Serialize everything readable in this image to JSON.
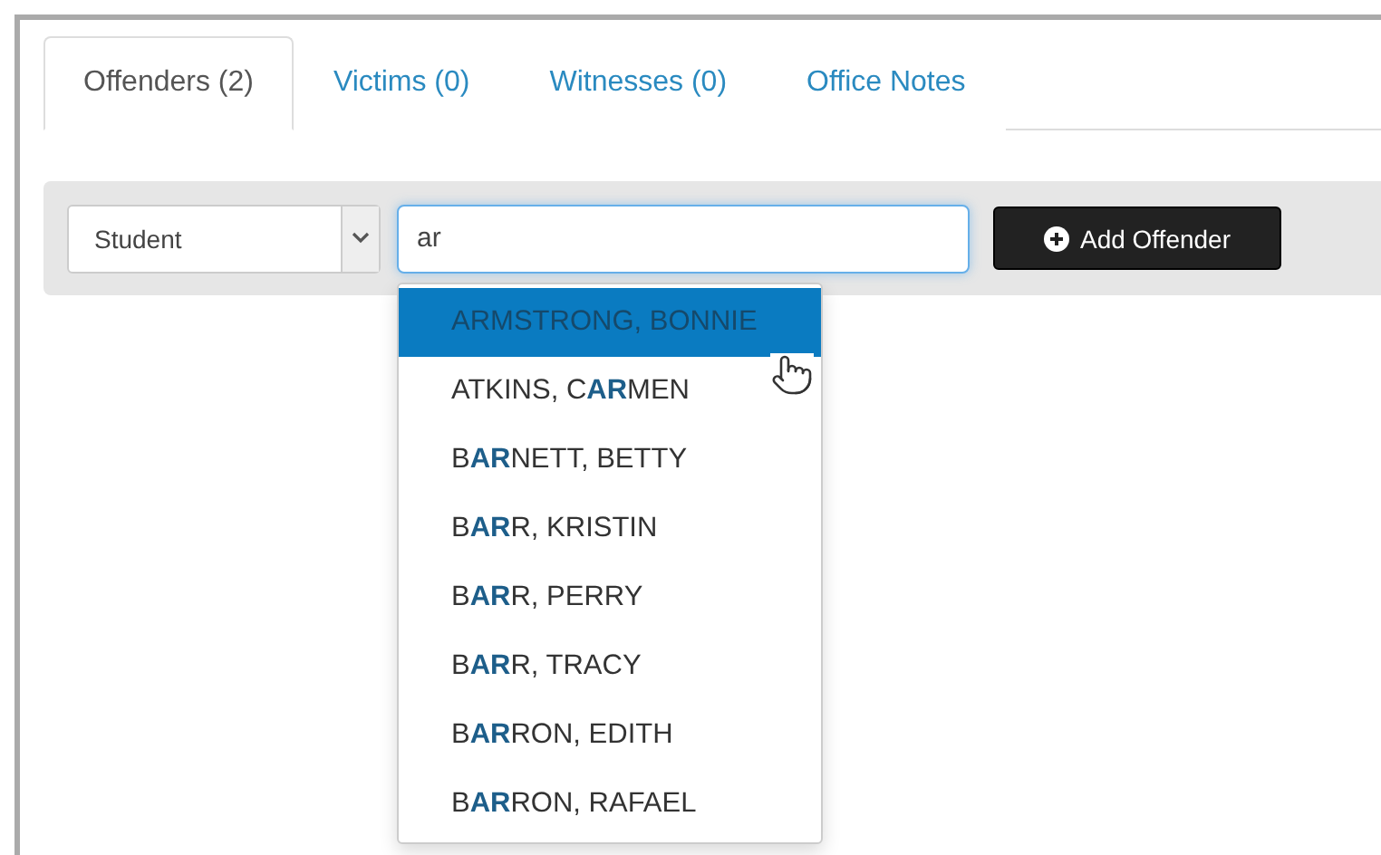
{
  "tabs": [
    {
      "label": "Offenders (2)",
      "selected": true
    },
    {
      "label": "Victims (0)",
      "selected": false
    },
    {
      "label": "Witnesses (0)",
      "selected": false
    },
    {
      "label": "Office Notes",
      "selected": false
    }
  ],
  "type_select": {
    "value": "Student"
  },
  "search": {
    "value": "ar"
  },
  "add_button": {
    "label": "Add Offender"
  },
  "suggestions": [
    {
      "label": "ARMSTRONG, BONNIE",
      "selected": true
    },
    {
      "label": "ATKINS, C**AR**MEN",
      "selected": false
    },
    {
      "label": "B**AR**NETT, BETTY",
      "selected": false
    },
    {
      "label": "B**AR**R, KRISTIN",
      "selected": false
    },
    {
      "label": "B**AR**R, PERRY",
      "selected": false
    },
    {
      "label": "B**AR**R, TRACY",
      "selected": false
    },
    {
      "label": "B**AR**RON, EDITH",
      "selected": false
    },
    {
      "label": "B**AR**RON, RAFAEL",
      "selected": false
    }
  ]
}
